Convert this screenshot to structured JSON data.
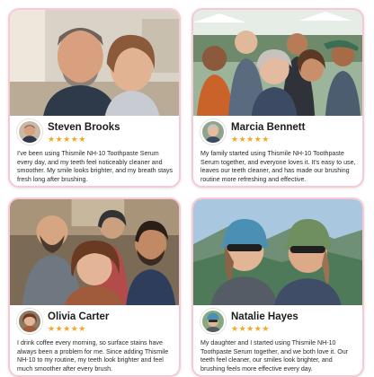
{
  "testimonials": [
    {
      "name": "Steven Brooks",
      "stars": "★★★★★",
      "rating": 5,
      "review": "I've been using Thismile NH-10 Toothpaste Serum every day, and my teeth feel noticeably cleaner and smoother. My smile looks brighter, and my breath stays fresh long after brushing."
    },
    {
      "name": "Marcia Bennett",
      "stars": "★★★★★",
      "rating": 5,
      "review": "My family started using Thismile NH-10 Toothpaste Serum together, and everyone loves it. It's easy to use, leaves our teeth cleaner, and has made our brushing routine more refreshing and effective."
    },
    {
      "name": "Olivia Carter",
      "stars": "★★★★★",
      "rating": 5,
      "review": "I drink coffee every morning, so surface stains have always been a problem for me. Since adding Thismile NH-10 to my routine, my teeth look brighter and feel much smoother after every brush."
    },
    {
      "name": "Natalie Hayes",
      "stars": "★★★★★",
      "rating": 5,
      "review": "My daughter and I started using Thismile NH-10 Toothpaste Serum together, and we both love it. Our teeth feel cleaner, our smiles look brighter, and brushing feels more effective every day."
    }
  ],
  "colors": {
    "card_border": "#f7c9d6",
    "star": "#f5a623",
    "name_text": "#1c1c1c",
    "body_text": "#2a2a2a"
  }
}
